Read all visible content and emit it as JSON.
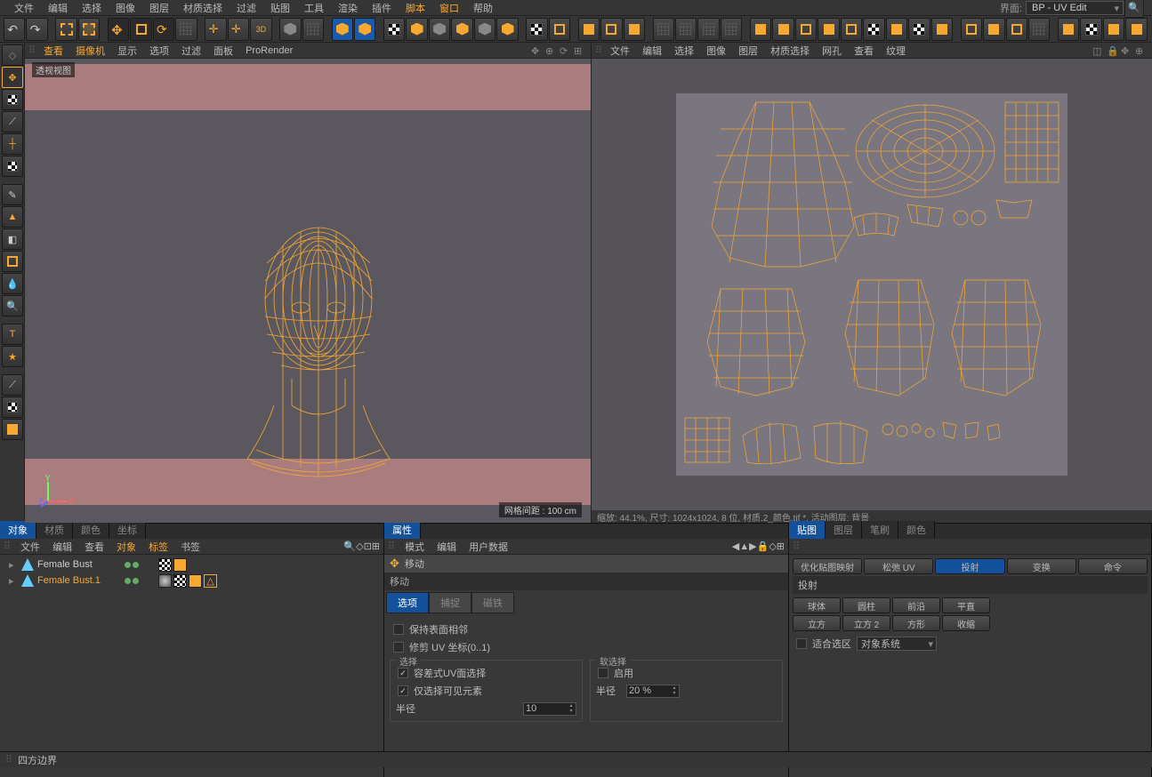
{
  "menu": {
    "items": [
      "文件",
      "编辑",
      "选择",
      "图像",
      "图层",
      "材质选择",
      "过滤",
      "贴图",
      "工具",
      "渲染",
      "插件",
      "脚本",
      "窗口",
      "帮助"
    ],
    "highlight": [
      11,
      12
    ],
    "layout_label": "界面:",
    "layout_value": "BP - UV Edit"
  },
  "viewport": {
    "menu": [
      "查看",
      "摄像机",
      "显示",
      "选项",
      "过滤",
      "面板",
      "ProRender"
    ],
    "menu_hl": [
      0,
      1
    ],
    "label": "透视视图",
    "grid_info": "网格间距 : 100 cm"
  },
  "uv": {
    "menu": [
      "文件",
      "编辑",
      "选择",
      "图像",
      "图层",
      "材质选择",
      "网孔",
      "查看",
      "纹理"
    ],
    "status": "缩放: 44.1%, 尺寸: 1024x1024, 8 位, 材质.2_颜色.tif *, 活动图层: 背景"
  },
  "om": {
    "tabs": [
      "对象",
      "材质",
      "颜色",
      "坐标"
    ],
    "menu": [
      "文件",
      "编辑",
      "查看",
      "对象",
      "标签",
      "书签"
    ],
    "menu_hl": [
      3,
      4
    ],
    "rows": [
      {
        "name": "Female Bust",
        "hl": false,
        "indent": 0
      },
      {
        "name": "Female Bust.1",
        "hl": true,
        "indent": 0
      }
    ]
  },
  "attr": {
    "tab": "属性",
    "menu": [
      "模式",
      "编辑",
      "用户数据"
    ],
    "tool_name": "移动",
    "section": "移动",
    "tabs": [
      "选项",
      "捕捉",
      "磁铁"
    ],
    "active_tab": 0,
    "opt1": "保持表面相邻",
    "opt2": "修剪 UV 坐标(0..1)",
    "fs1": {
      "title": "选择",
      "opt1": "容差式UV面选择",
      "opt2": "仅选择可见元素",
      "radius_label": "半径",
      "radius_val": "10"
    },
    "fs2": {
      "title": "软选择",
      "enable": "启用",
      "radius_label": "半径",
      "radius_val": "20 %"
    }
  },
  "tex": {
    "tabs": [
      "贴图",
      "图层",
      "笔刷",
      "颜色"
    ],
    "row1": [
      "优化贴图映射",
      "松弛 UV",
      "投射",
      "变换",
      "命令"
    ],
    "row1_active": 2,
    "section": "投射",
    "row2": [
      "球体",
      "圆柱",
      "前沿",
      "平直"
    ],
    "row3": [
      "立方",
      "立方 2",
      "方形",
      "收缩"
    ],
    "fit_label": "适合选区",
    "fit_dd": "对象系统"
  },
  "status": "四方边界"
}
